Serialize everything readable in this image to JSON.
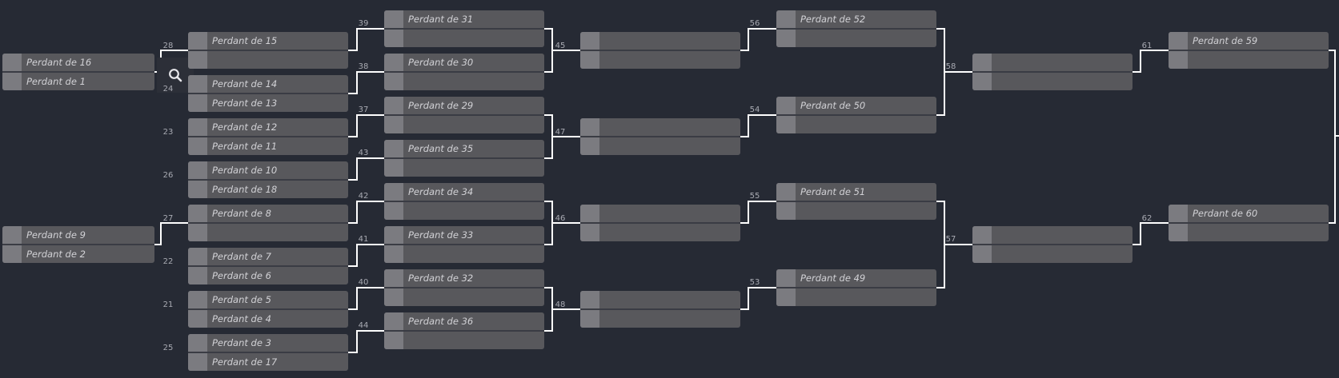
{
  "colors": {
    "background": "#262a34",
    "match_bg": "#58585c",
    "seed_bg": "#7b7b80",
    "text": "#d2d2d6",
    "connector": "#ffffff"
  },
  "search_button": {
    "icon": "search-icon"
  },
  "matches": [
    {
      "id": "m-r0-1",
      "top": "Perdant de 16",
      "bottom": "Perdant de 1"
    },
    {
      "id": "m-r0-2",
      "top": "Perdant de 9",
      "bottom": "Perdant de 2"
    },
    {
      "id": "28",
      "top": "Perdant de 15",
      "bottom": ""
    },
    {
      "id": "24",
      "top": "Perdant de 14",
      "bottom": "Perdant de 13"
    },
    {
      "id": "23",
      "top": "Perdant de 12",
      "bottom": "Perdant de 11"
    },
    {
      "id": "26",
      "top": "Perdant de 10",
      "bottom": "Perdant de 18"
    },
    {
      "id": "27",
      "top": "Perdant de 8",
      "bottom": ""
    },
    {
      "id": "22",
      "top": "Perdant de 7",
      "bottom": "Perdant de 6"
    },
    {
      "id": "21",
      "top": "Perdant de 5",
      "bottom": "Perdant de 4"
    },
    {
      "id": "25",
      "top": "Perdant de 3",
      "bottom": "Perdant de 17"
    },
    {
      "id": "39",
      "top": "Perdant de 31",
      "bottom": ""
    },
    {
      "id": "38",
      "top": "Perdant de 30",
      "bottom": ""
    },
    {
      "id": "37",
      "top": "Perdant de 29",
      "bottom": ""
    },
    {
      "id": "43",
      "top": "Perdant de 35",
      "bottom": ""
    },
    {
      "id": "42",
      "top": "Perdant de 34",
      "bottom": ""
    },
    {
      "id": "41",
      "top": "Perdant de 33",
      "bottom": ""
    },
    {
      "id": "40",
      "top": "Perdant de 32",
      "bottom": ""
    },
    {
      "id": "44",
      "top": "Perdant de 36",
      "bottom": ""
    },
    {
      "id": "45",
      "top": "",
      "bottom": ""
    },
    {
      "id": "47",
      "top": "",
      "bottom": ""
    },
    {
      "id": "46",
      "top": "",
      "bottom": ""
    },
    {
      "id": "48",
      "top": "",
      "bottom": ""
    },
    {
      "id": "56",
      "top": "Perdant de 52",
      "bottom": ""
    },
    {
      "id": "54",
      "top": "Perdant de 50",
      "bottom": ""
    },
    {
      "id": "55",
      "top": "Perdant de 51",
      "bottom": ""
    },
    {
      "id": "53",
      "top": "Perdant de 49",
      "bottom": ""
    },
    {
      "id": "58",
      "top": "",
      "bottom": ""
    },
    {
      "id": "57",
      "top": "",
      "bottom": ""
    },
    {
      "id": "61",
      "top": "Perdant de 59",
      "bottom": ""
    },
    {
      "id": "62",
      "top": "Perdant de 60",
      "bottom": ""
    }
  ],
  "labels": {
    "n28": "28",
    "n24": "24",
    "n23": "23",
    "n26": "26",
    "n27": "27",
    "n22": "22",
    "n21": "21",
    "n25": "25",
    "n39": "39",
    "n38": "38",
    "n37": "37",
    "n43": "43",
    "n42": "42",
    "n41": "41",
    "n40": "40",
    "n44": "44",
    "n45": "45",
    "n47": "47",
    "n46": "46",
    "n48": "48",
    "n56": "56",
    "n54": "54",
    "n55": "55",
    "n53": "53",
    "n58": "58",
    "n57": "57",
    "n61": "61",
    "n62": "62"
  }
}
